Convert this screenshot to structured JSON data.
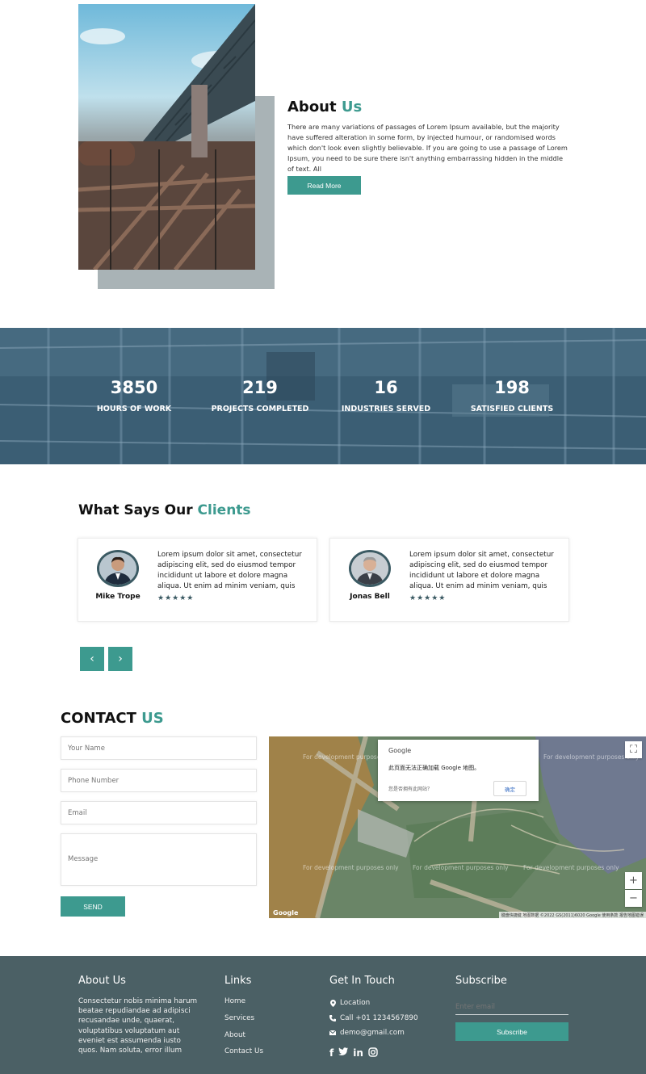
{
  "about": {
    "title": "About",
    "title_accent": "Us",
    "text": "There are many variations of passages of Lorem Ipsum available, but the majority have suffered alteration in some form, by injected humour, or randomised words which don't look even slightly believable. If you are going to use a passage of Lorem Ipsum, you need to be sure there isn't anything embarrassing hidden in the middle of text. All",
    "button": "Read More"
  },
  "stats": [
    {
      "value": "3850",
      "label": "HOURS OF WORK"
    },
    {
      "value": "219",
      "label": "PROJECTS COMPLETED"
    },
    {
      "value": "16",
      "label": "INDUSTRIES SERVED"
    },
    {
      "value": "198",
      "label": "SATISFIED CLIENTS"
    }
  ],
  "clients": {
    "title": "What Says Our",
    "title_accent": "Clients",
    "cards": [
      {
        "name": "Mike Trope",
        "text": "Lorem ipsum dolor sit amet, consectetur adipiscing elit, sed do eiusmod tempor incididunt ut labore et dolore magna aliqua. Ut enim ad minim veniam, quis",
        "stars": "★★★★★"
      },
      {
        "name": "Jonas Bell",
        "text": "Lorem ipsum dolor sit amet, consectetur adipiscing elit, sed do eiusmod tempor incididunt ut labore et dolore magna aliqua. Ut enim ad minim veniam, quis",
        "stars": "★★★★★"
      }
    ],
    "prev": "‹",
    "next": "›"
  },
  "contact": {
    "title": "CONTACT",
    "title_accent": "US",
    "name_placeholder": "Your Name",
    "phone_placeholder": "Phone Number",
    "email_placeholder": "Email",
    "message_placeholder": "Message",
    "send": "SEND"
  },
  "map": {
    "dialog_logo": "Google",
    "dialog_message": "此页面无法正确加载 Google 地图。",
    "dialog_link": "您是否拥有此网站？",
    "dialog_ok": "确定",
    "dev_text": "For development purposes only",
    "zoom_in": "+",
    "zoom_out": "−",
    "fullscreen": "⛶",
    "footer": "键盘快捷键  地图数据 ©2022 GS(2011)6020 Google  使用条款  报告地图错误",
    "logo": "Google"
  },
  "footer": {
    "about_title": "About Us",
    "about_text": "Consectetur nobis minima harum beatae repudiandae ad adipisci recusandae unde, quaerat, voluptatibus voluptatum aut eveniet est assumenda iusto quos. Nam soluta, error illum",
    "links_title": "Links",
    "links": [
      "Home",
      "Services",
      "About",
      "Contact Us"
    ],
    "touch_title": "Get In Touch",
    "location": "Location",
    "phone": "Call +01 1234567890",
    "email": "demo@gmail.com",
    "subscribe_title": "Subscribe",
    "subscribe_placeholder": "Enter email",
    "subscribe_button": "Subscribe"
  },
  "colors": {
    "accent": "#3d9a8f",
    "footer_bg": "#4b6065",
    "stats_overlay": "#3a5d73"
  }
}
